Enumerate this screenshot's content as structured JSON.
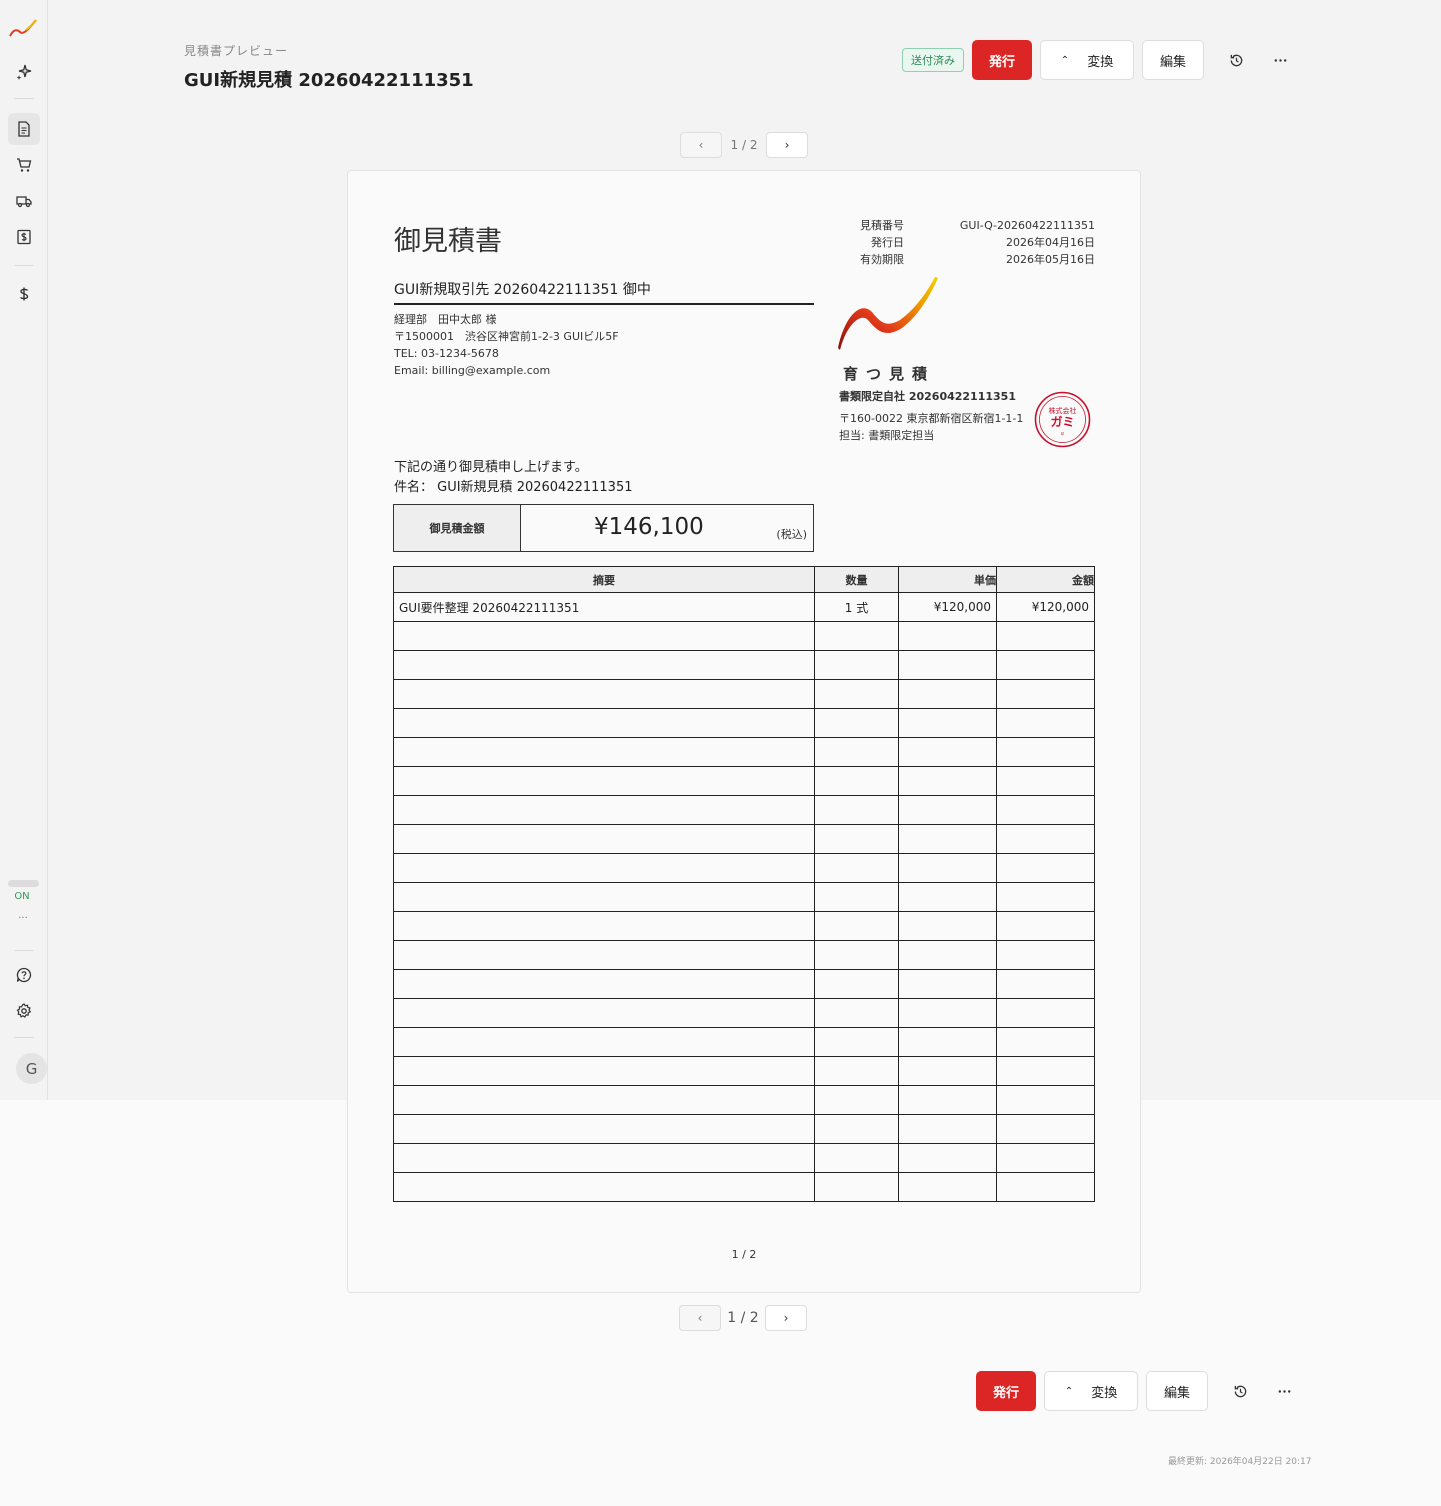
{
  "app": {
    "logo": "growth-curve-logo",
    "connection_status": "ON",
    "connection_more": "...",
    "avatar_initial": "G"
  },
  "sidebar": {
    "items": [
      {
        "name": "sparkle-icon"
      },
      {
        "name": "document-icon",
        "active": true
      },
      {
        "name": "cart-icon"
      },
      {
        "name": "truck-icon"
      },
      {
        "name": "invoice-icon"
      },
      {
        "name": "dollar-icon"
      },
      {
        "name": "help-icon"
      },
      {
        "name": "gear-icon"
      }
    ]
  },
  "header": {
    "subtitle": "見積書プレビュー",
    "title": "GUI新規見積 20260422111351"
  },
  "toolbar": {
    "status_badge": "送付済み",
    "issue_label": "発行",
    "convert_label": "変換",
    "edit_label": "編集"
  },
  "pager": {
    "page_text": "1 / 2"
  },
  "document": {
    "title": "御見積書",
    "meta": [
      {
        "label": "見積番号",
        "value": "GUI-Q-20260422111351"
      },
      {
        "label": "発行日",
        "value": "2026年04月16日"
      },
      {
        "label": "有効期限",
        "value": "2026年05月16日"
      }
    ],
    "client": {
      "name": "GUI新規取引先 20260422111351 御中",
      "lines": [
        "経理部　田中太郎 様",
        "〒1500001　渋谷区神宮前1-2-3 GUIビル5F",
        "TEL: 03-1234-5678",
        "Email: billing@example.com"
      ]
    },
    "company": {
      "brand": "育つ見積",
      "name": "書類限定自社 20260422111351",
      "address": "〒160-0022 東京都新宿区新宿1-1-1",
      "contact": "担当: 書類限定担当",
      "seal_top": "株式会社",
      "seal_main": "ガミ",
      "seal_color": "#c8102e"
    },
    "greeting": "下記の通り御見積申し上げます。",
    "subject": "件名： GUI新規見積 20260422111351",
    "total_label": "御見積金額",
    "total_amount": "¥146,100",
    "total_tax": "(税込)",
    "table": {
      "headers": [
        "摘要",
        "数量",
        "単価",
        "金額"
      ],
      "rows": [
        [
          "GUI要件整理 20260422111351",
          "1 式",
          "¥120,000",
          "¥120,000"
        ]
      ],
      "empty_rows": 20
    },
    "page_footer": "1 / 2"
  },
  "footer": {
    "updated": "最終更新: 2026年04月22日 20:17"
  },
  "colors": {
    "primary": "#dc2626",
    "badge_text": "#2d8a56",
    "badge_bg": "#eaf7f0"
  }
}
